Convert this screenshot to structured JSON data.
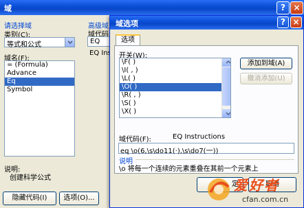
{
  "back_dialog": {
    "title": "域",
    "section_choose_field": "请选择域",
    "category_label": "类别(C):",
    "category_value": "等式和公式",
    "field_names_label": "域名(F):",
    "field_names": [
      "= (Formula)",
      "Advance",
      "Eq",
      "Symbol"
    ],
    "selected_field_index": 2,
    "advanced_label": "高级域",
    "field_code_label": "域代码",
    "field_code_value": "EQ",
    "field_code_desc": "EQ Instr",
    "description_label": "说明:",
    "description_text": "创建科学公式",
    "hide_codes_button": "隐藏代码(I)",
    "options_button": "选项(O)..."
  },
  "front_dialog": {
    "title": "域选项",
    "tab_options": "选项",
    "switches_label": "开关(W):",
    "switches": [
      "\\F( )",
      "\\I( , )",
      "\\L( )",
      "\\O( )",
      "\\R( , )",
      "\\S( )",
      "\\X( )"
    ],
    "selected_switch_index": 3,
    "add_to_field_button": "添加到域(A)",
    "undo_add_button": "撤消添加(U)",
    "field_code_label": "域代码(F):",
    "field_code_desc": "EQ Instructions",
    "field_code_value": "eq \\o(6,\\s\\do11(·),\\s\\do7(一))",
    "description_label": "说明",
    "description_text": "\\o 将每一个连续的元素重叠在其前一个元素上",
    "ok_button_partial": "定",
    "cancel_button": "取消"
  },
  "watermark": {
    "brand": "爱好者",
    "site": "cfan.com.cn"
  }
}
